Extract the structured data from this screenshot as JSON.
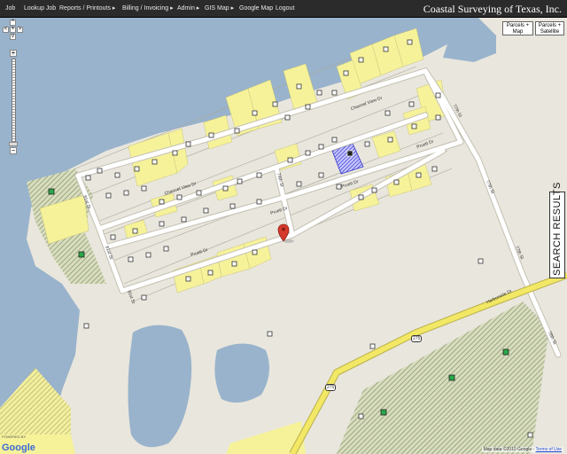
{
  "nav": {
    "items": [
      "Job",
      "Lookup Job",
      "Reports / Printouts ▸",
      "Billing / Invoicing ▸",
      "Admin ▸",
      "GIS Map ▸",
      "Google Map",
      "Logout"
    ],
    "brand": "Coastal Surveying of Texas, Inc."
  },
  "map_type": {
    "parcels_map": "Parcels + Map",
    "parcels_satellite": "Parcels + Satellite"
  },
  "search_results_label": "SEARCH RESULTS",
  "streets": [
    "Channel View Dr",
    "Channel View Dr",
    "Pruett Dr",
    "Pruett Dr",
    "Pruett Dr",
    "Pruett Dr",
    "81st St",
    "81st St",
    "81st St",
    "79th St",
    "77th St",
    "77th St",
    "77th St",
    "78th St",
    "Harborside Dr",
    "275",
    "275"
  ],
  "attribution": {
    "powered_by": "POWERED BY",
    "google": "Google",
    "copyright": "Map data ©2010 Google -",
    "terms": "Terms of Use"
  },
  "colors": {
    "water": "#99b3cc",
    "land": "#e9e6dd",
    "parcel_highlight": "#f6f29a",
    "road": "#ffffff",
    "highway": "#f2e866",
    "selected_parcel": "#3333cc",
    "marker_red": "#d63a2c"
  }
}
